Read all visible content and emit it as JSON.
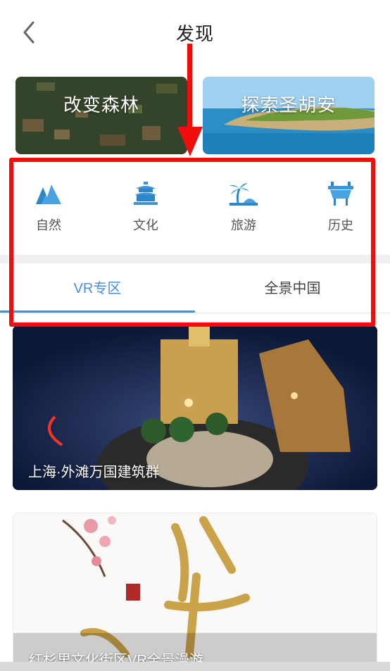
{
  "header": {
    "title": "发现",
    "back_icon": "chevron-left-icon"
  },
  "banners": [
    {
      "label": "改变森林"
    },
    {
      "label": "探索圣胡安"
    }
  ],
  "categories": [
    {
      "label": "自然",
      "icon": "mountain-icon"
    },
    {
      "label": "文化",
      "icon": "temple-icon"
    },
    {
      "label": "旅游",
      "icon": "palm-tree-icon"
    },
    {
      "label": "历史",
      "icon": "ancient-bronze-vessel-icon"
    }
  ],
  "tabs": [
    {
      "label": "VR专区",
      "active": true
    },
    {
      "label": "全景中国",
      "active": false
    }
  ],
  "cards": [
    {
      "title": "上海·外滩万国建筑群"
    },
    {
      "title": "红杉里文化街区VR全景漫游"
    }
  ],
  "colors": {
    "accent": "#4a8fd9",
    "annotation": "#f20d0d"
  }
}
